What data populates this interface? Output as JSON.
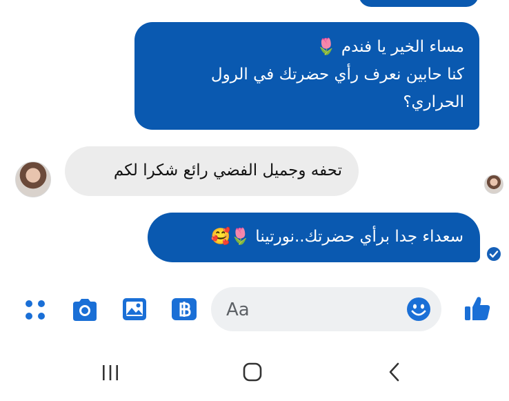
{
  "messages": [
    {
      "direction": "outgoing",
      "lines": [
        "مساء الخير يا فندم 🌷",
        "كنا حابين نعرف رأي حضرتك في الرول",
        "الحراري؟"
      ]
    },
    {
      "direction": "incoming",
      "lines": [
        "تحفه وجميل الفضي رائع شكرا لكم"
      ]
    },
    {
      "direction": "outgoing",
      "lines": [
        "سعداء جدا برأي حضرتك..نورتينا 🌷🥰"
      ]
    }
  ],
  "composer": {
    "placeholder": "Aa",
    "icons": [
      "apps-icon",
      "camera-icon",
      "gallery-icon",
      "gif-icon",
      "emoji-icon",
      "thumbs-up-icon"
    ]
  },
  "status": {
    "seen_indicator": "avatar",
    "sent_indicator": "delivered-check-icon"
  },
  "navigation": [
    "recent-apps-button",
    "home-button",
    "back-button"
  ],
  "colors": {
    "outgoing_bubble": "#0a59b0",
    "incoming_bubble": "#ececec",
    "accent": "#1a6fd6"
  }
}
